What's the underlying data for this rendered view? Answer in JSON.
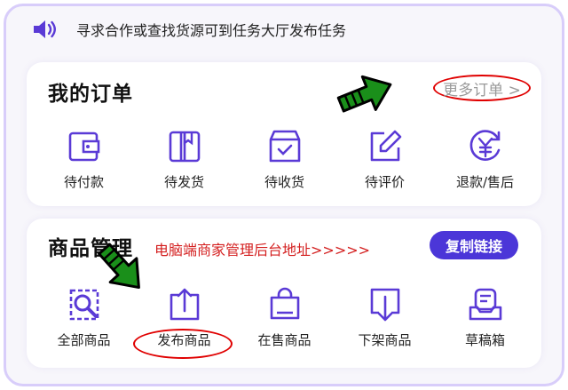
{
  "notice": {
    "text": "寻求合作或查找货源可到任务大厅发布任务",
    "icon": "speaker-icon"
  },
  "orders": {
    "title": "我的订单",
    "more_label": "更多订单 >",
    "items": [
      {
        "label": "待付款",
        "icon": "wallet-icon"
      },
      {
        "label": "待发货",
        "icon": "book-icon"
      },
      {
        "label": "待收货",
        "icon": "box-check-icon"
      },
      {
        "label": "待评价",
        "icon": "edit-icon"
      },
      {
        "label": "退款/售后",
        "icon": "refund-yen-icon"
      }
    ]
  },
  "goods": {
    "title": "商品管理",
    "annotation": "电脑端商家管理后台地址>>>>>",
    "copy_label": "复制链接",
    "items": [
      {
        "label": "全部商品",
        "icon": "search-doc-icon"
      },
      {
        "label": "发布商品",
        "icon": "upload-icon"
      },
      {
        "label": "在售商品",
        "icon": "shopping-bag-icon"
      },
      {
        "label": "下架商品",
        "icon": "download-icon"
      },
      {
        "label": "草稿箱",
        "icon": "draft-box-icon"
      }
    ]
  },
  "colors": {
    "accent": "#4b36d8",
    "icon": "#5a3ad6",
    "annotation": "#e00000",
    "arrow": "#1a8f1a"
  }
}
